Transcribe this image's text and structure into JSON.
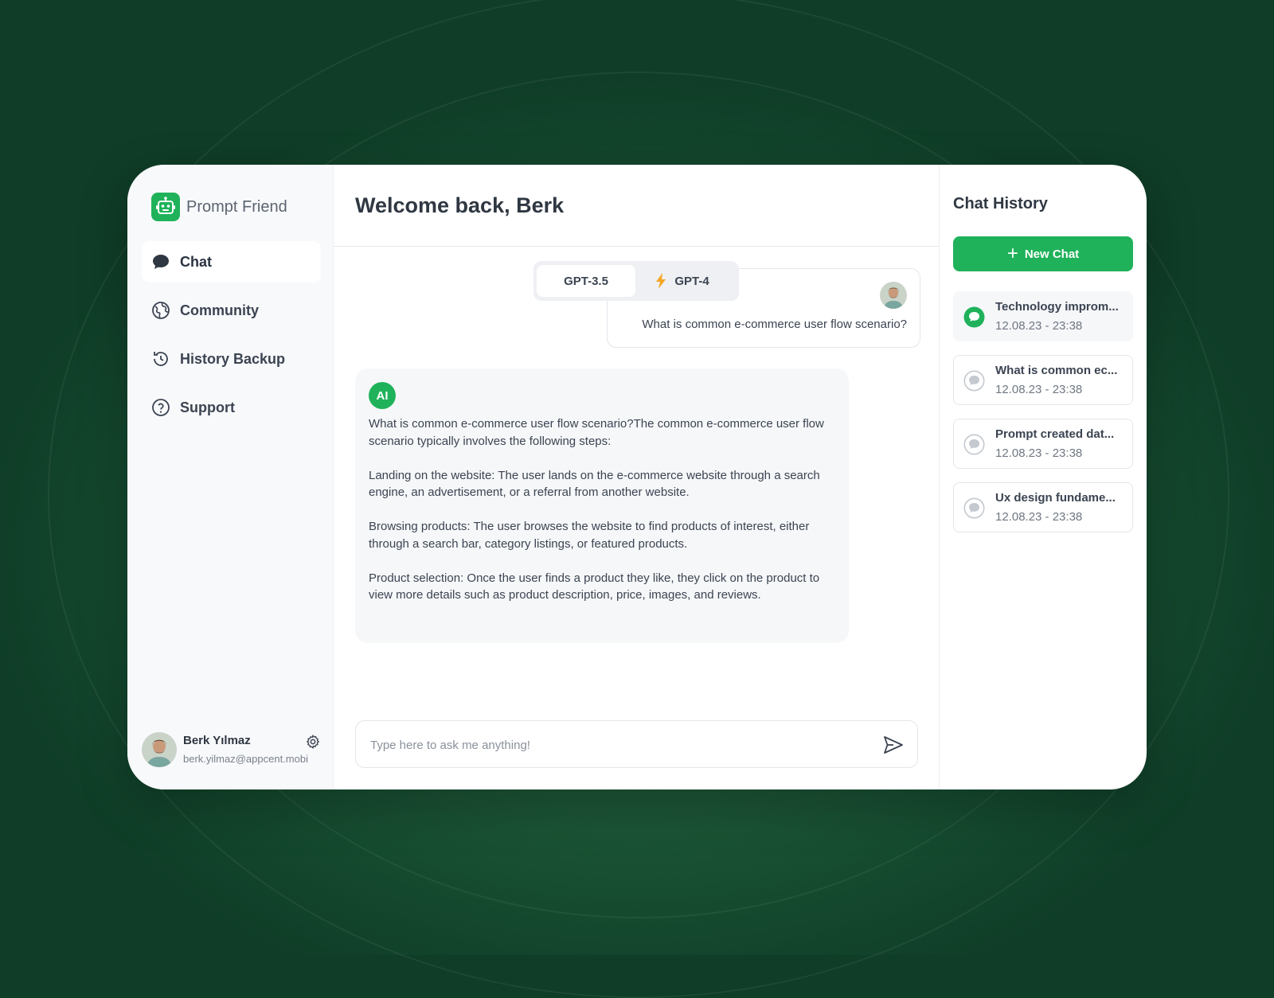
{
  "app": {
    "name": "Prompt Friend"
  },
  "sidebar": {
    "items": [
      {
        "label": "Chat",
        "icon": "chat-bubble-icon",
        "active": true
      },
      {
        "label": "Community",
        "icon": "globe-icon",
        "active": false
      },
      {
        "label": "History Backup",
        "icon": "history-icon",
        "active": false
      },
      {
        "label": "Support",
        "icon": "help-circle-icon",
        "active": false
      }
    ],
    "profile": {
      "name": "Berk Yılmaz",
      "email": "berk.yilmaz@appcent.mobi"
    }
  },
  "main": {
    "title": "Welcome back, Berk",
    "models": {
      "active": "GPT-3.5",
      "alt": "GPT-4"
    },
    "user_message": "What is common e-commerce user flow scenario?",
    "ai_badge": "AI",
    "ai_response": [
      "What is common e-commerce user flow scenario?The common e-commerce user flow scenario typically involves the following steps:",
      "Landing on the website: The user lands on the e-commerce website through a search engine, an advertisement, or a referral from another website.",
      "Browsing products: The user browses the website to find products of interest, either through a search bar, category listings, or featured products.",
      "Product selection: Once the user finds a product they like, they click on the product to view more details such as product description, price, images, and reviews."
    ],
    "input": {
      "placeholder": "Type here to ask me anything!",
      "value": ""
    }
  },
  "history": {
    "title": "Chat History",
    "new_chat_label": "New Chat",
    "items": [
      {
        "title": "Technology improm...",
        "date": "12.08.23 - 23:38",
        "active": true
      },
      {
        "title": "What is common ec...",
        "date": "12.08.23 - 23:38",
        "active": false
      },
      {
        "title": "Prompt created dat...",
        "date": "12.08.23 - 23:38",
        "active": false
      },
      {
        "title": "Ux design fundame...",
        "date": "12.08.23 - 23:38",
        "active": false
      }
    ]
  },
  "colors": {
    "accent": "#1fb25a",
    "background": "#1c5438",
    "lightning": "#f5a623"
  }
}
